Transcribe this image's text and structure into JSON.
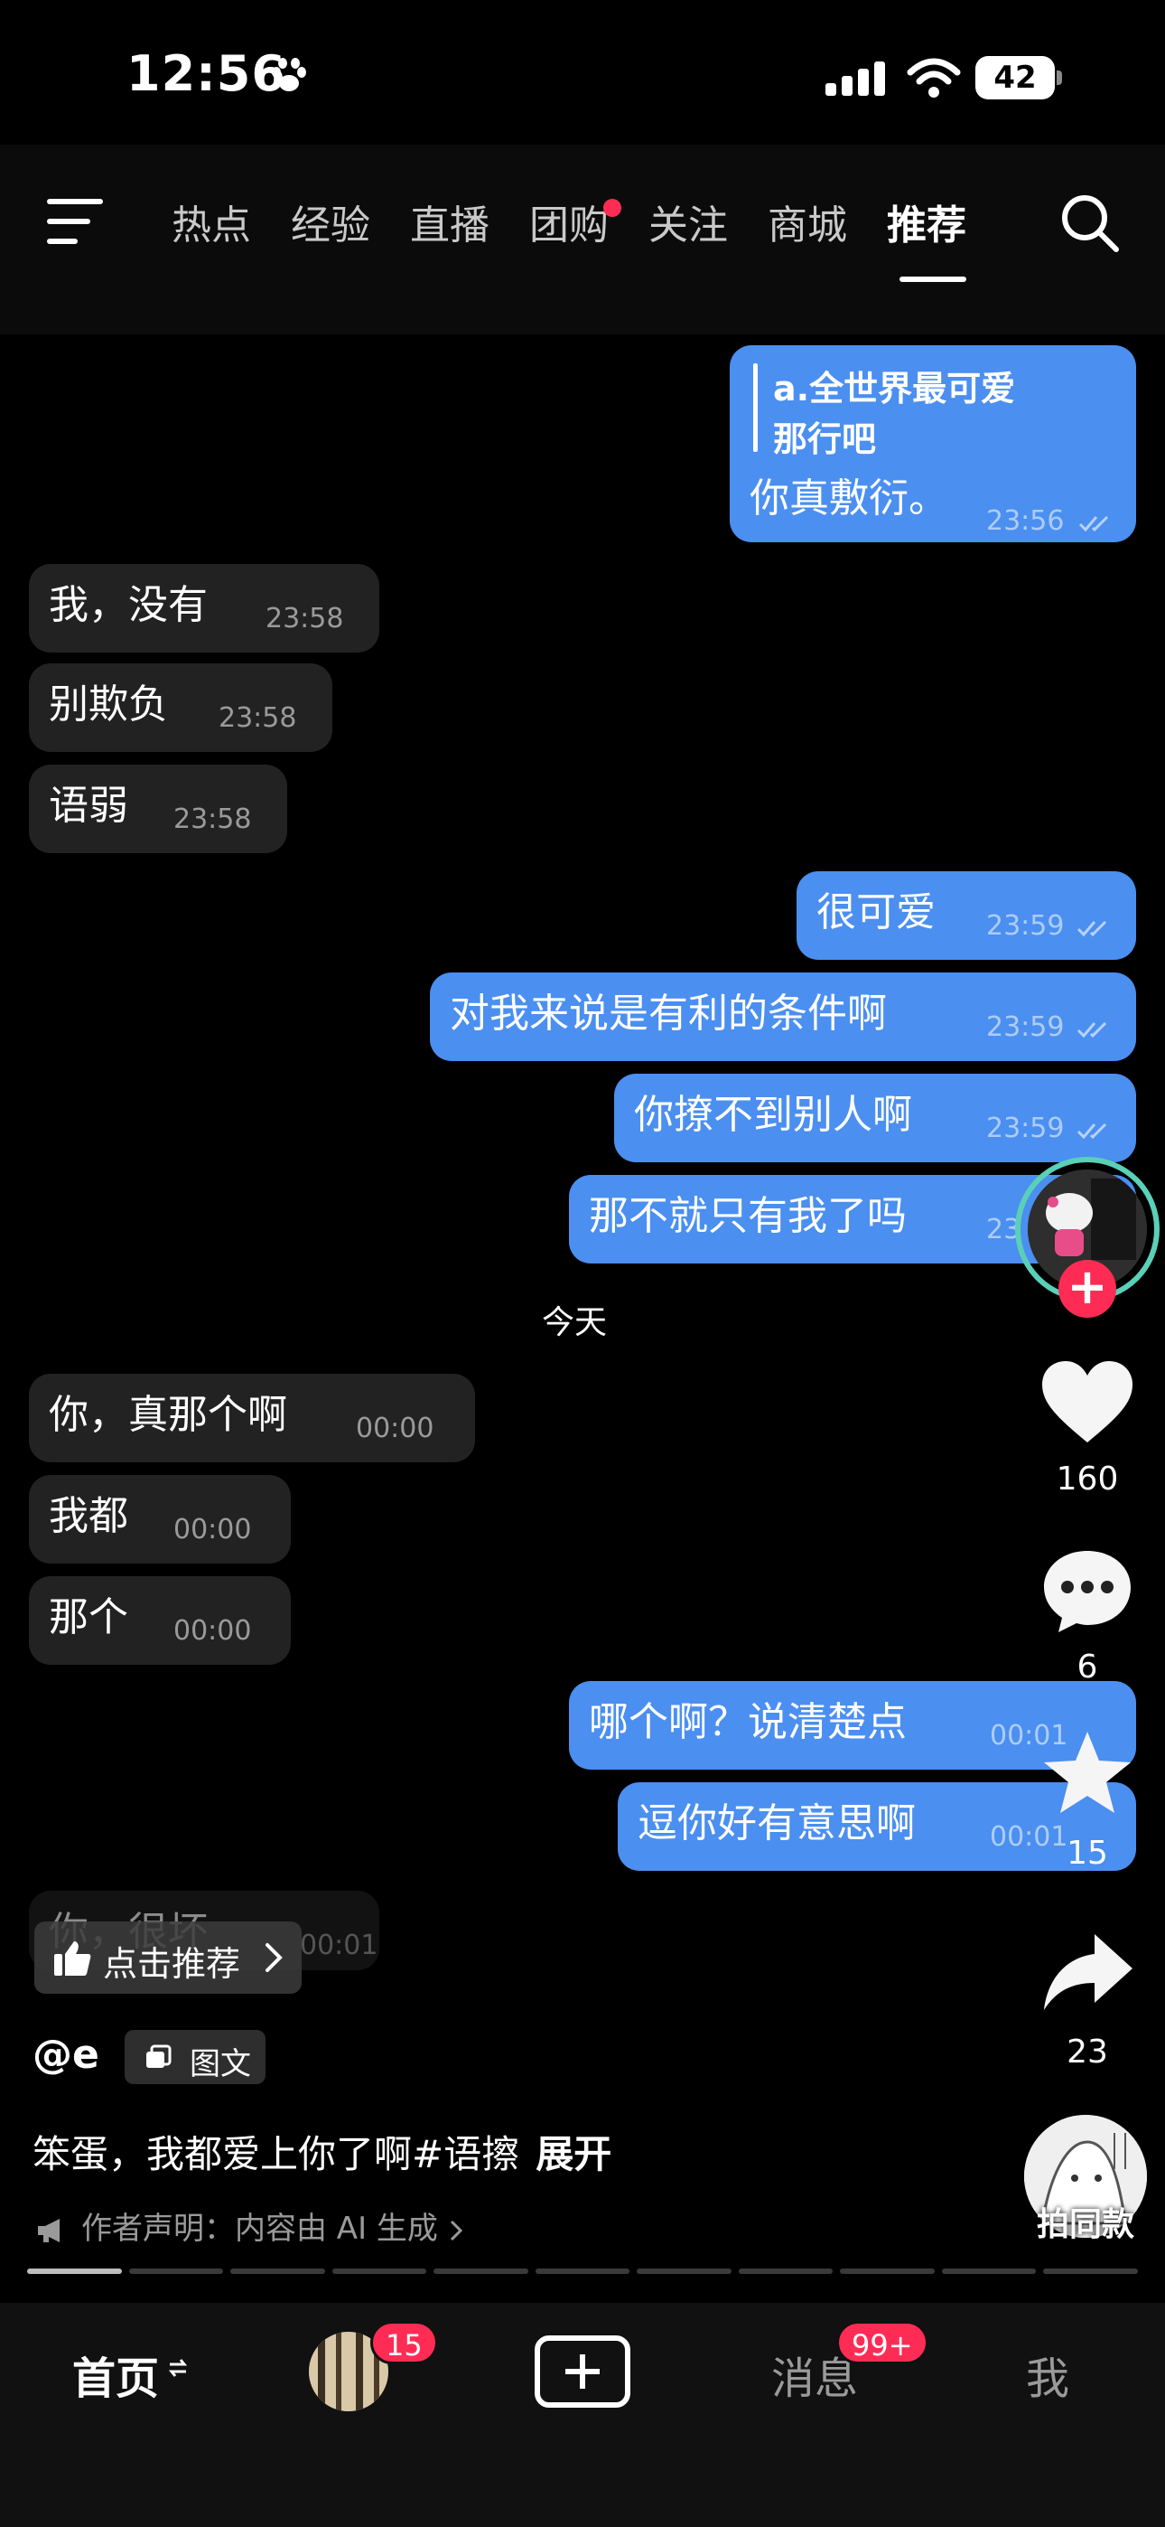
{
  "status_bar": {
    "time": "12:56",
    "battery": "42"
  },
  "nav": {
    "tabs": [
      "热点",
      "经验",
      "直播",
      "团购",
      "关注",
      "商城",
      "推荐"
    ],
    "active_tab": "推荐",
    "dot_tab": "团购"
  },
  "chat": {
    "quoted": {
      "line1": "a.全世界最可爱",
      "line2": "那行吧"
    },
    "messages": [
      {
        "dir": "out",
        "text": "你真敷衍。",
        "time": "23:56"
      },
      {
        "dir": "in",
        "text": "我，没有",
        "time": "23:58"
      },
      {
        "dir": "in",
        "text": "别欺负",
        "time": "23:58"
      },
      {
        "dir": "in",
        "text": "语弱",
        "time": "23:58"
      },
      {
        "dir": "out",
        "text": "很可爱",
        "time": "23:59"
      },
      {
        "dir": "out",
        "text": "对我来说是有利的条件啊",
        "time": "23:59"
      },
      {
        "dir": "out",
        "text": "你撩不到别人啊",
        "time": "23:59"
      },
      {
        "dir": "out",
        "text": "那不就只有我了吗",
        "time": "23"
      },
      {
        "dir": "in",
        "text": "你，真那个啊",
        "time": "00:00"
      },
      {
        "dir": "in",
        "text": "我都",
        "time": "00:00"
      },
      {
        "dir": "in",
        "text": "那个",
        "time": "00:00"
      },
      {
        "dir": "out",
        "text": "哪个啊？说清楚点",
        "time": "00:01"
      },
      {
        "dir": "out",
        "text": "逗你好有意思啊",
        "time": "00:01"
      },
      {
        "dir": "in",
        "text": "你，很坏",
        "time": "00:01"
      }
    ],
    "date_separator": "今天"
  },
  "rail": {
    "likes": "160",
    "comments": "6",
    "favorites": "15",
    "shares": "23"
  },
  "post": {
    "recommend_label": "点击推荐",
    "author": "@e",
    "type_label": "图文",
    "caption": "笨蛋，我都爱上你了啊#语擦",
    "expand": "展开",
    "disclaimer": "作者声明：内容由 AI 生成",
    "same_style": "拍同款"
  },
  "tabbar": {
    "home": "首页",
    "friend_badge": "15",
    "messages": "消息",
    "messages_badge": "99+",
    "me": "我"
  },
  "colors": {
    "outgoing_bubble": "#4b8ff0",
    "incoming_bubble": "#222222",
    "badge": "#fe2c55"
  }
}
